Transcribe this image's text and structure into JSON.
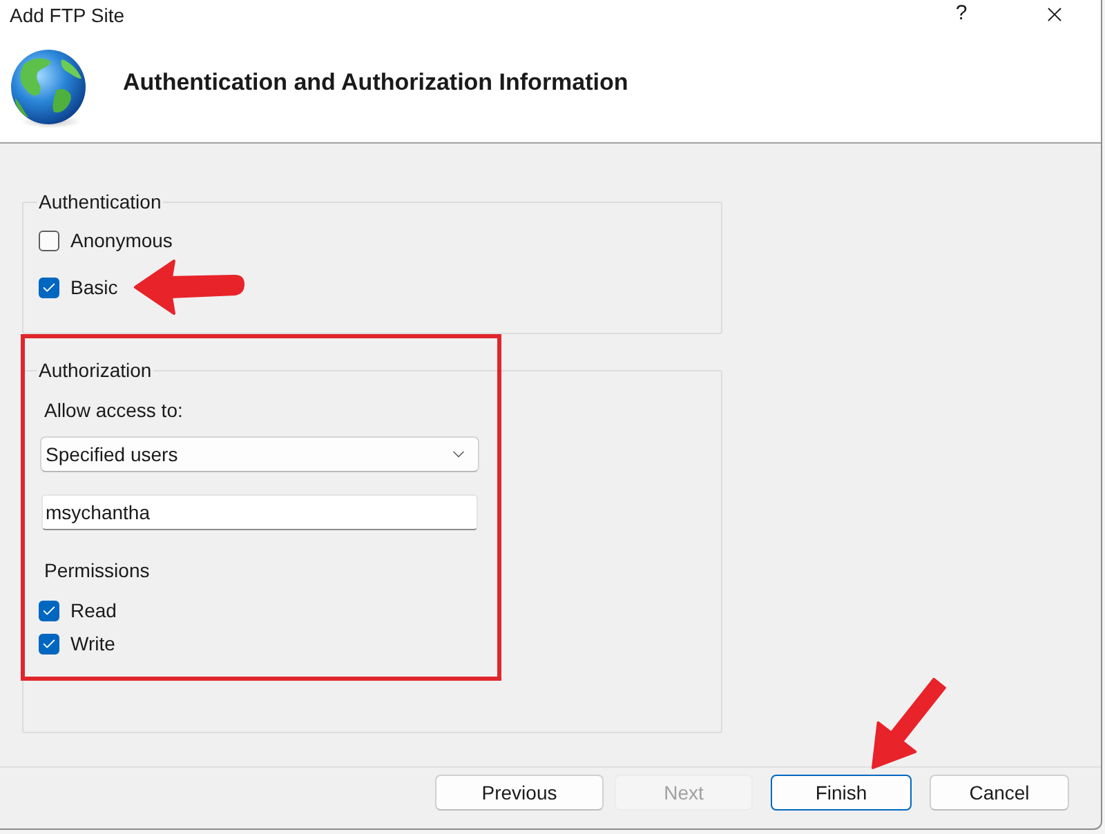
{
  "window": {
    "title": "Add FTP Site",
    "help_button": "?"
  },
  "header": {
    "title": "Authentication and Authorization Information"
  },
  "authentication": {
    "legend": "Authentication",
    "options": [
      {
        "label": "Anonymous",
        "checked": false
      },
      {
        "label": "Basic",
        "checked": true
      }
    ]
  },
  "authorization": {
    "legend": "Authorization",
    "allow_access_label": "Allow access to:",
    "allow_access": {
      "value": "Specified users"
    },
    "users_field": {
      "value": "msychantha"
    },
    "permissions_label": "Permissions",
    "permissions": [
      {
        "label": "Read",
        "checked": true
      },
      {
        "label": "Write",
        "checked": true
      }
    ]
  },
  "buttons": [
    {
      "label": "Previous",
      "disabled": false,
      "default": false
    },
    {
      "label": "Next",
      "disabled": true,
      "default": false
    },
    {
      "label": "Finish",
      "disabled": false,
      "default": true
    },
    {
      "label": "Cancel",
      "disabled": false,
      "default": false
    }
  ]
}
